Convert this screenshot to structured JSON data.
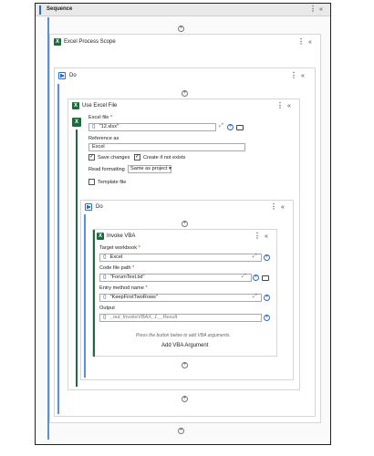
{
  "sequence": {
    "title": "Sequence"
  },
  "excel_scope": {
    "title": "Excel Process Scope"
  },
  "outer_do": {
    "title": "Do"
  },
  "use_excel": {
    "title": "Use Excel File",
    "excel_file_label": "Excel file",
    "excel_file_value": "\"12.xlsx\"",
    "reference_label": "Reference as",
    "reference_value": "Excel",
    "save_changes_label": "Save changes",
    "create_label": "Create if not exists",
    "read_formatting_label": "Read formatting",
    "read_formatting_value": "Same as project",
    "template_label": "Template file"
  },
  "inner_do": {
    "title": "Do"
  },
  "invoke_vba": {
    "title": "Invoke VBA",
    "target_label": "Target workbook",
    "target_value": "Excel",
    "code_label": "Code file path",
    "code_value": "\"ForumText.txt\"",
    "entry_label": "Entry method name",
    "entry_value": "\"KeepFirstTwoRows\"",
    "output_label": "Output",
    "output_value": "_out_InvokeVBAX_1__Result",
    "hint": "Press the button below to add VBA arguments.",
    "add_button": "Add VBA Argument"
  },
  "glyphs": {
    "brace": "{}",
    "req": "*",
    "kebab": "⋮",
    "collapse": "«",
    "plus": "+",
    "check": "✓",
    "expand": "⤢",
    "excel": "X"
  }
}
